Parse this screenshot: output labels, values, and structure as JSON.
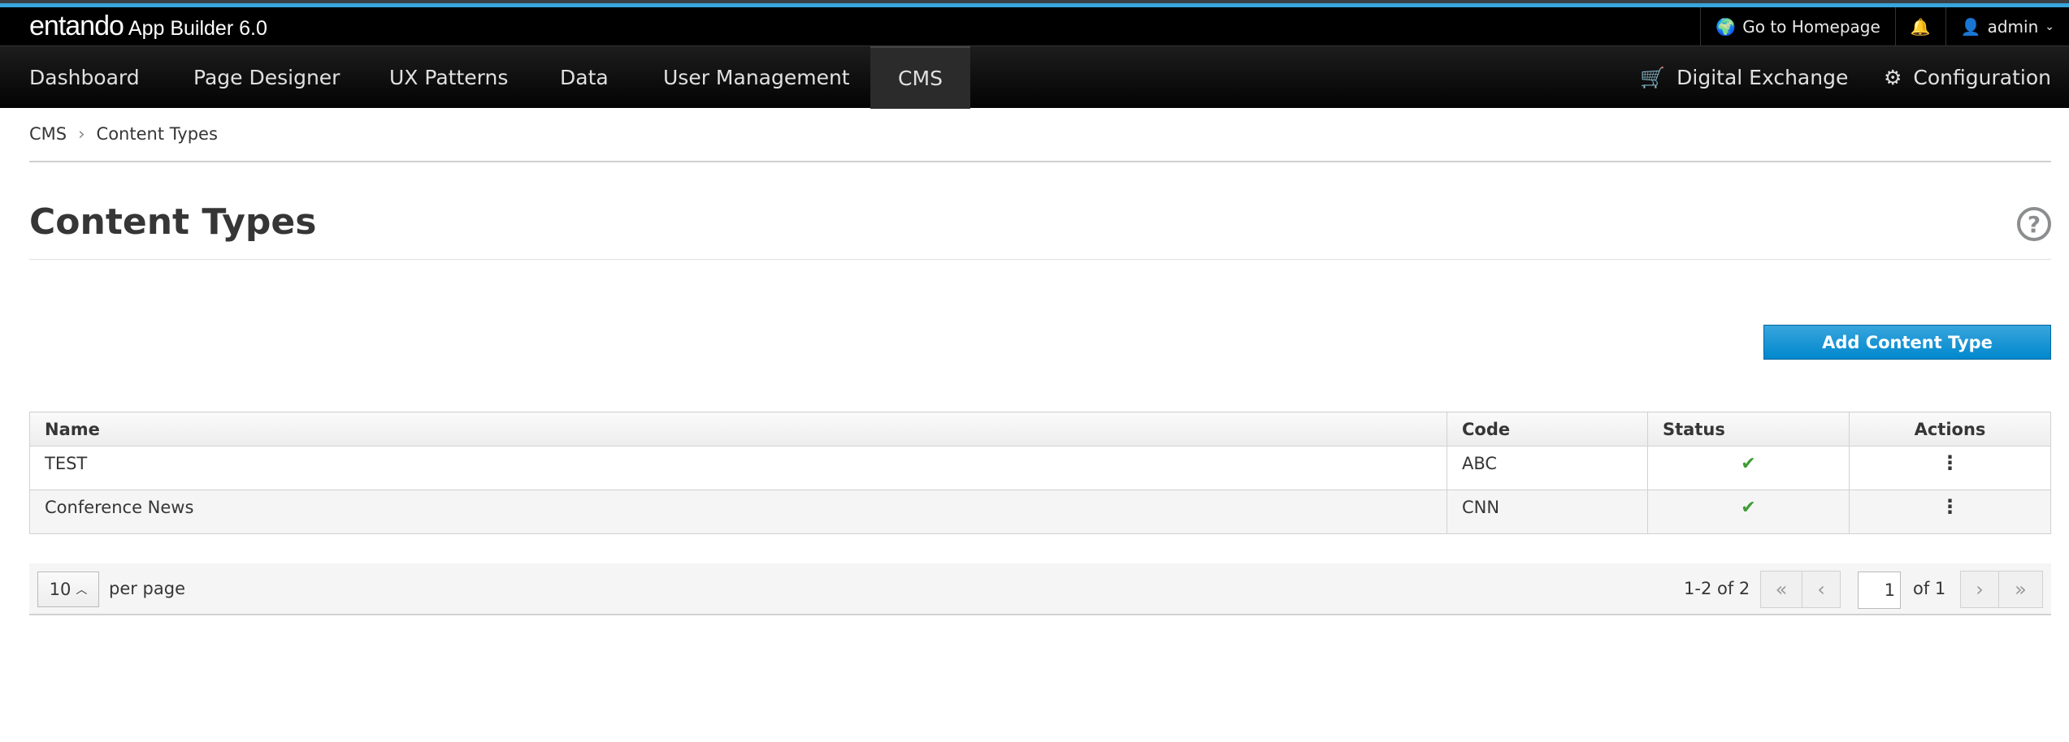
{
  "brand": {
    "logo": "entando",
    "app": "App Builder 6.0"
  },
  "util": {
    "homepage": "Go to Homepage",
    "user": "admin"
  },
  "nav": {
    "items": [
      "Dashboard",
      "Page Designer",
      "UX Patterns",
      "Data",
      "User Management",
      "CMS"
    ],
    "digital_exchange": "Digital Exchange",
    "configuration": "Configuration"
  },
  "breadcrumb": [
    "CMS",
    "Content Types"
  ],
  "page": {
    "title": "Content Types",
    "help": "?",
    "add_button": "Add Content Type"
  },
  "table": {
    "headers": [
      "Name",
      "Code",
      "Status",
      "Actions"
    ],
    "rows": [
      {
        "name": "TEST",
        "code": "ABC"
      },
      {
        "name": "Conference News",
        "code": "CNN"
      }
    ]
  },
  "pagination": {
    "per_page_value": "10",
    "per_page_label": "per page",
    "range": "1-2 of 2",
    "page": "1",
    "of": "of 1"
  }
}
